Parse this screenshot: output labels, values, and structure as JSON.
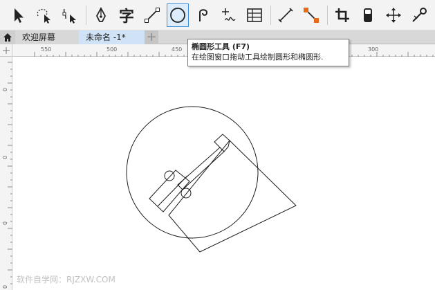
{
  "toolbar": {
    "tools": [
      {
        "name": "pick-tool",
        "icon": "arrow-pointer-icon"
      },
      {
        "name": "freehand-pick-tool",
        "icon": "lasso-pointer-icon"
      },
      {
        "name": "shape-tool",
        "icon": "node-pointer-icon"
      },
      {
        "name": "pen-tool",
        "icon": "pen-nib-icon"
      },
      {
        "name": "text-tool",
        "icon": "text-icon",
        "label": "字"
      },
      {
        "name": "line-tool",
        "icon": "line-icon"
      },
      {
        "name": "ellipse-tool",
        "icon": "ellipse-icon",
        "active": true
      },
      {
        "name": "spiral-tool",
        "icon": "spiral-icon"
      },
      {
        "name": "smart-drawing-tool",
        "icon": "cursor-wave-icon"
      },
      {
        "name": "table-tool",
        "icon": "table-grid-icon"
      },
      {
        "name": "dimension-tool",
        "icon": "dimension-line-icon"
      },
      {
        "name": "connector-tool",
        "icon": "connector-icon"
      },
      {
        "name": "crop-tool",
        "icon": "crop-icon"
      },
      {
        "name": "fill-tool",
        "icon": "fill-bucket-icon"
      },
      {
        "name": "pan-tool",
        "icon": "move-arrows-icon"
      },
      {
        "name": "eyedropper-tool",
        "icon": "eyedropper-icon"
      }
    ],
    "accent_color": "#3b8ed8"
  },
  "tabs": {
    "home_icon": "home-icon",
    "welcome_label": "欢迎屏幕",
    "document_label": "未命名 -1*",
    "new_tab_label": "+"
  },
  "ruler": {
    "h_labels": [
      "550",
      "500",
      "450",
      "300"
    ],
    "v_labels": [
      "0",
      "0",
      "0",
      "0"
    ]
  },
  "tooltip": {
    "title": "椭圆形工具 (F7)",
    "description": "在绘图窗口拖动工具绘制圆形和椭圆形."
  },
  "watermark": "软件自学网：RJZXW.COM"
}
